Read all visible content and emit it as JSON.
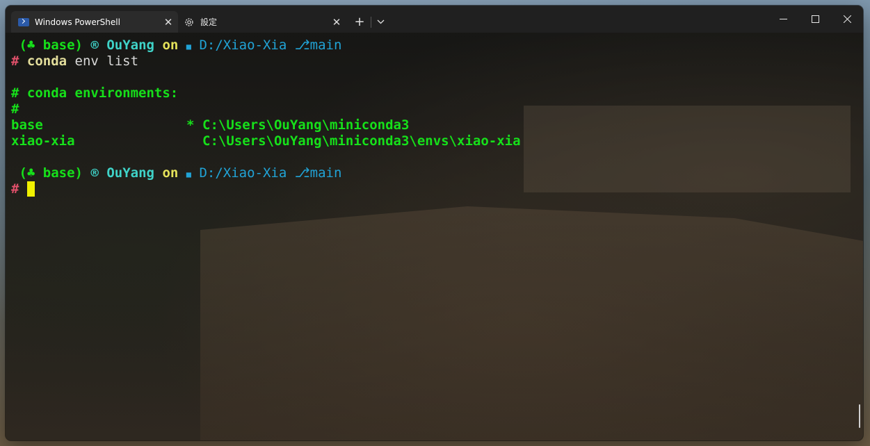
{
  "tabs": [
    {
      "label": "Windows PowerShell",
      "icon": "powershell-icon",
      "active": true
    },
    {
      "label": "設定",
      "icon": "gear-icon",
      "active": false
    }
  ],
  "titlebar": {
    "new_tab_symbol": "+",
    "dropdown_symbol": "⌄",
    "close_symbol": "✕",
    "minimize_symbol": "—",
    "maximize_symbol": "☐"
  },
  "prompt": {
    "env_prefix": " (",
    "env_icon": "♣",
    "env_name": " base)",
    "user_icon": "®",
    "user": "OuYang",
    "on": "on",
    "folder_icon": "■",
    "path": "D:/Xiao-Xia",
    "branch_icon": "⎇",
    "branch": "main",
    "hash": "#"
  },
  "session": {
    "command_bin": "conda",
    "command_args": " env list",
    "header": "# conda environments:",
    "comment_hash": "#",
    "envs": [
      {
        "name": "base",
        "marker": "*",
        "path": "C:\\Users\\OuYang\\miniconda3"
      },
      {
        "name": "xiao-xia",
        "marker": " ",
        "path": "C:\\Users\\OuYang\\miniconda3\\envs\\xiao-xia"
      }
    ]
  },
  "colors": {
    "prompt_env": "#16e01a",
    "prompt_user": "#3fd3c8",
    "prompt_path": "#21a3d6",
    "prompt_hash": "#e0506a",
    "output": "#16e01a",
    "cursor": "#f0f000"
  }
}
